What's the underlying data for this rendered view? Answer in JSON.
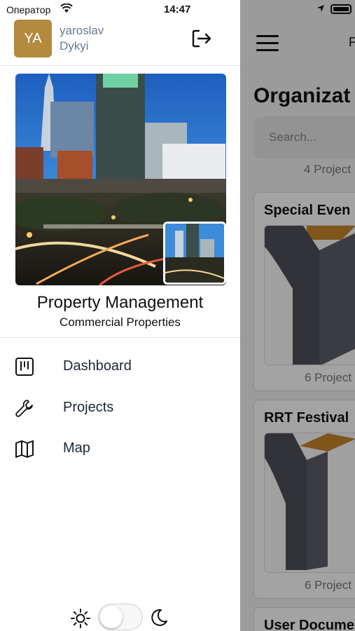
{
  "status_bar": {
    "carrier": "Оператор",
    "time": "14:47"
  },
  "profile": {
    "initials": "YA",
    "first_name": "yaroslav",
    "last_name": "Dykyi",
    "avatar_color": "#b38a3e"
  },
  "organization": {
    "name": "Property Management",
    "subtitle": "Commercial Properties"
  },
  "nav": {
    "items": [
      {
        "label": "Dashboard",
        "icon": "dashboard-icon"
      },
      {
        "label": "Projects",
        "icon": "wrench-icon"
      },
      {
        "label": "Map",
        "icon": "map-icon"
      }
    ]
  },
  "theme": {
    "light_icon": "sun-icon",
    "dark_icon": "moon-icon",
    "dark_mode": false
  },
  "background_screen": {
    "title": "Organizat",
    "search_placeholder": "Search...",
    "cards": [
      {
        "title": "",
        "count": "4 Project"
      },
      {
        "title": "Special Even",
        "count": "6 Project"
      },
      {
        "title": "RRT Festival",
        "count": "6 Project"
      },
      {
        "title": "User Docume",
        "count": ""
      }
    ],
    "header_letter": "P"
  }
}
